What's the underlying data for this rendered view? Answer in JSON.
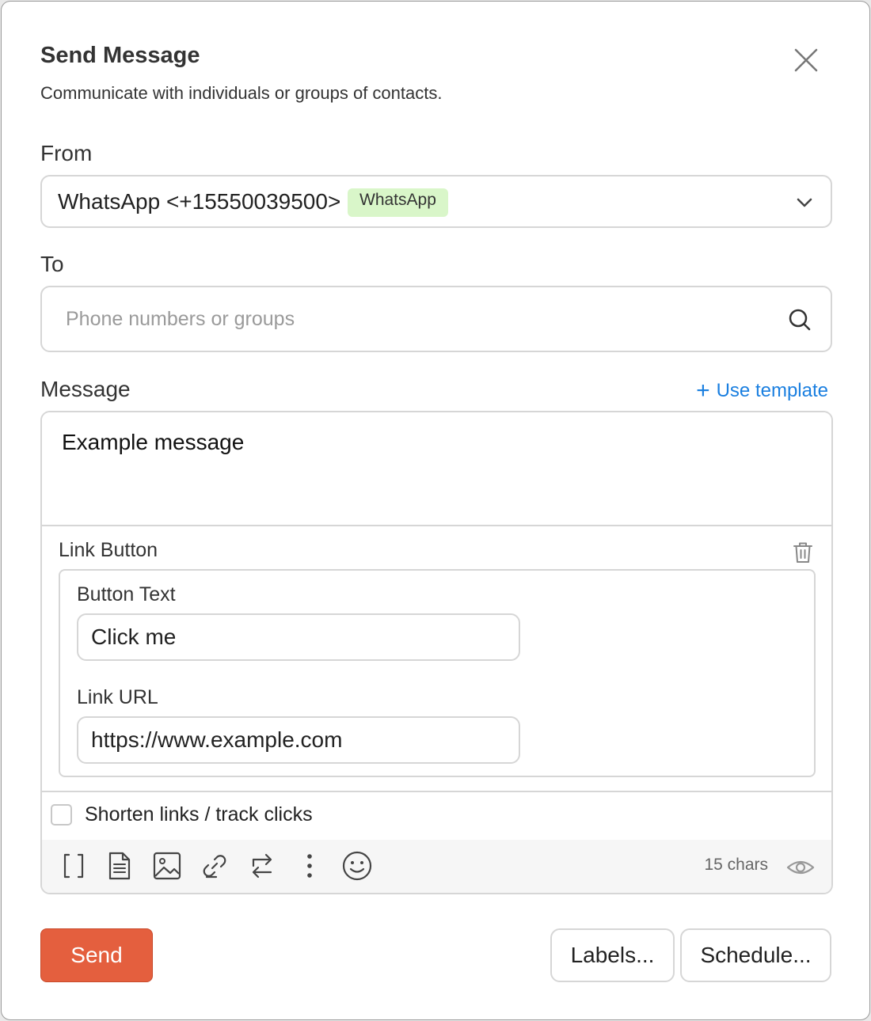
{
  "dialog": {
    "title": "Send Message",
    "subtitle": "Communicate with individuals or groups of contacts.",
    "close_icon": "close-icon"
  },
  "from": {
    "label": "From",
    "value": "WhatsApp <+15550039500>",
    "badge": "WhatsApp",
    "badge_color": "#d9f6c9"
  },
  "to": {
    "label": "To",
    "placeholder": "Phone numbers or groups",
    "value": ""
  },
  "message": {
    "label": "Message",
    "use_template": "Use template",
    "text": "Example message",
    "link_button": {
      "title": "Link Button",
      "button_text_label": "Button Text",
      "button_text_value": "Click me",
      "link_url_label": "Link URL",
      "link_url_value": "https://www.example.com"
    },
    "shorten_links_label": "Shorten links / track clicks",
    "shorten_links_checked": false,
    "toolbar_icons": [
      "brackets-icon",
      "document-icon",
      "image-icon",
      "link-icon",
      "swap-icon",
      "more-vertical-icon",
      "emoji-icon"
    ],
    "char_count": "15 chars"
  },
  "actions": {
    "send": "Send",
    "labels": "Labels...",
    "schedule": "Schedule..."
  },
  "colors": {
    "accent_link": "#1a7fe0",
    "send_button": "#e45f3e"
  }
}
